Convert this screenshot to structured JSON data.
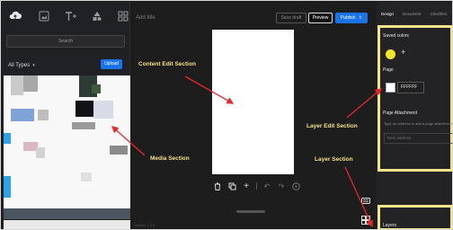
{
  "left": {
    "search_placeholder": "Search",
    "filter_label": "All Types",
    "upload_label": "Upload"
  },
  "center": {
    "title_placeholder": "Add title",
    "save_draft": "Save draft",
    "preview": "Preview",
    "publish": "Publish",
    "version": "Version 1.3.0"
  },
  "right": {
    "tabs": [
      "Design",
      "Document",
      "Checklist"
    ],
    "saved_colors": "Saved colors",
    "page_label": "Page",
    "page_hex": "FFFFFF",
    "page_attachment": "Page Attachment",
    "attachment_help": "Type an address to add a page attachment",
    "attachment_placeholder": "Web address",
    "layers_label": "Layers"
  },
  "annotations": {
    "content_edit": "Content Edit Section",
    "media": "Media Section",
    "layer_edit": "Layer Edit Section",
    "layer": "Layer Section"
  },
  "colors": {
    "accent": "#1a73e8",
    "annotation_yellow": "#f3e08a",
    "arrow_red": "#e8262a",
    "saved_color_yellow": "#f6e32c"
  }
}
